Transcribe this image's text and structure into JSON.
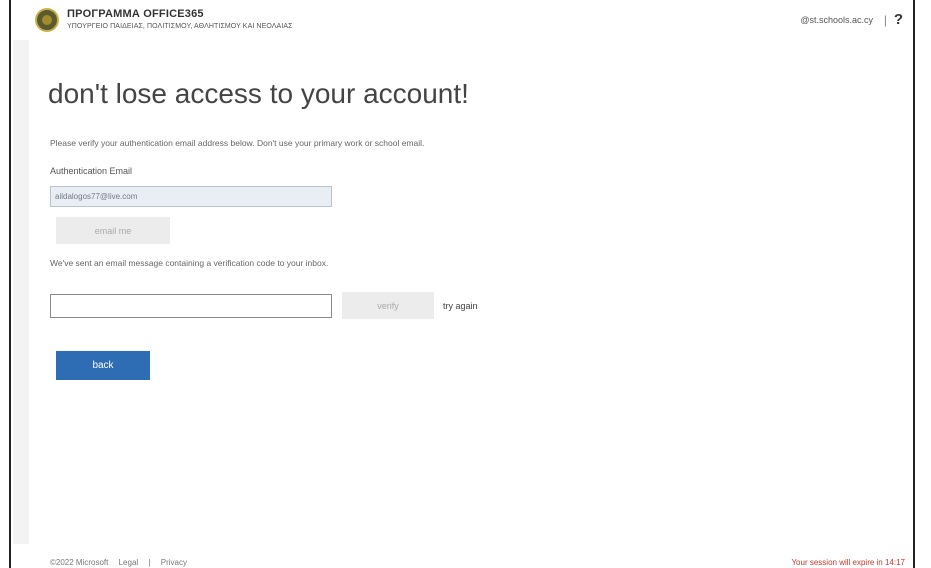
{
  "header": {
    "brand_title": "ΠΡΟΓΡΑΜΜΑ OFFICE365",
    "brand_subtitle": "ΥΠΟΥΡΓΕΙΟ ΠΑΙΔΕΙΑΣ, ΠΟΛΙΤΙΣΜΟΥ, ΑΘΛΗΤΙΣΜΟΥ ΚΑΙ ΝΕΟΛΑΙΑΣ",
    "user_email": "@st.schools.ac.cy",
    "separator": "|",
    "help_icon": "?"
  },
  "main": {
    "title": "don't lose access to your account!",
    "instructions": "Please verify your authentication email address below. Don't use your primary work or school email.",
    "email_label": "Authentication Email",
    "email_value": "aildalogos77@live.com",
    "email_me_label": "email me",
    "sent_message": "We've sent an email message containing a verification code to your inbox.",
    "code_value": "",
    "verify_label": "verify",
    "try_again_label": "try again",
    "back_label": "back"
  },
  "footer": {
    "copyright": "©2022 Microsoft",
    "legal": "Legal",
    "privacy": "Privacy",
    "session_notice": "Your session will expire in 14:17"
  },
  "colors": {
    "accent": "#2e6db4",
    "warning": "#c0392b",
    "input_fill": "#e8eef4"
  }
}
